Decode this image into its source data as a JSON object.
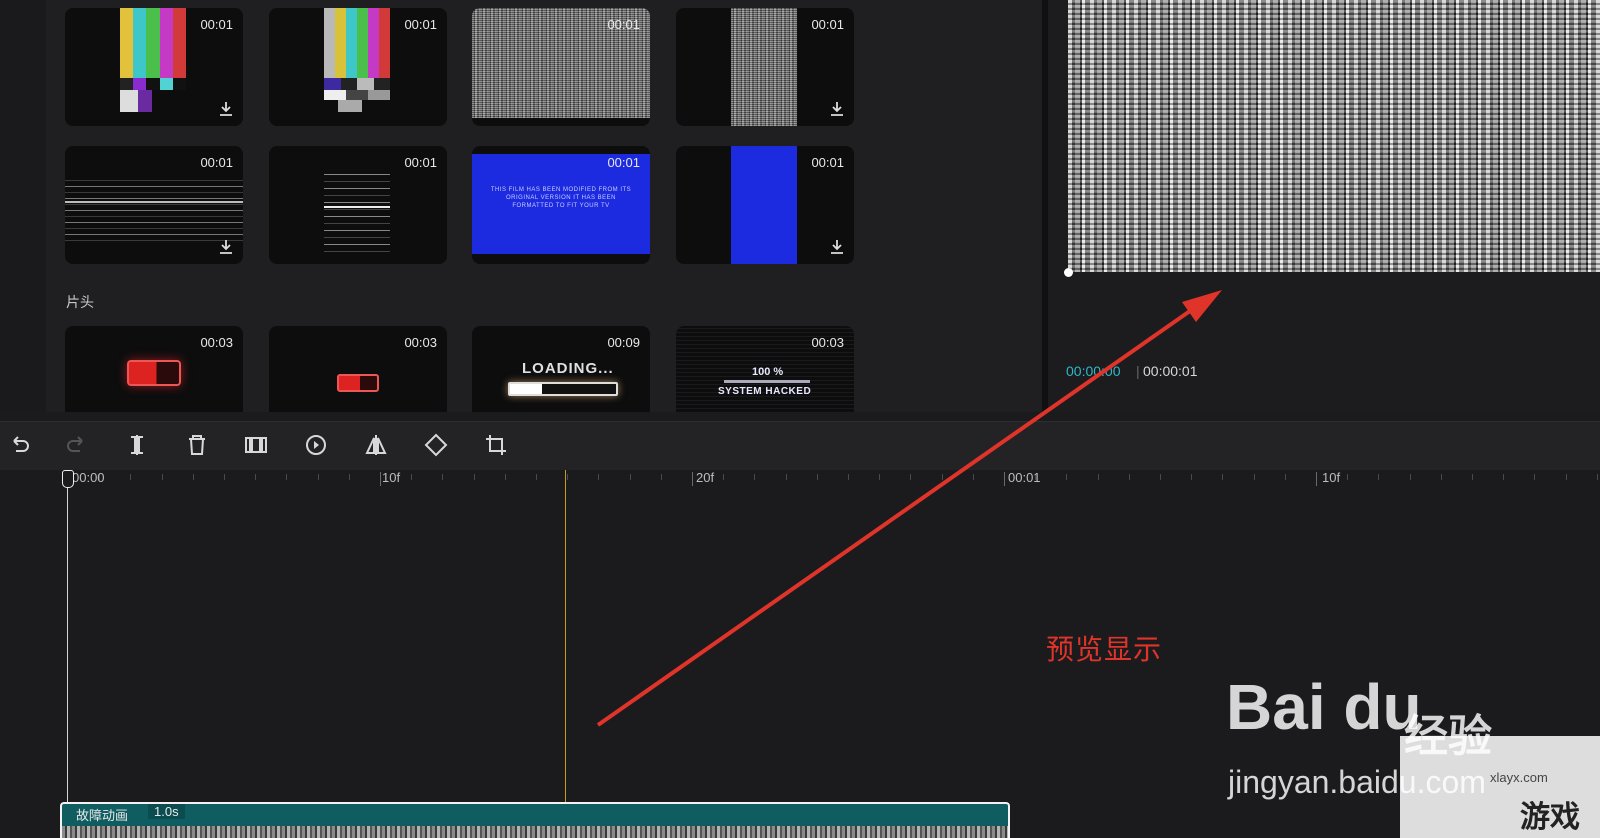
{
  "media": {
    "cards": [
      {
        "duration": "00:01",
        "style": "bars"
      },
      {
        "duration": "00:01",
        "style": "bars-narrow"
      },
      {
        "duration": "00:01",
        "style": "noise"
      },
      {
        "duration": "00:01",
        "style": "noise-narrow"
      },
      {
        "duration": "00:01",
        "style": "lines"
      },
      {
        "duration": "00:01",
        "style": "lines-narrow"
      },
      {
        "duration": "00:01",
        "style": "blue",
        "text": "THIS FILM HAS BEEN MODIFIED FROM ITS ORIGINAL VERSION IT HAS BEEN FORMATTED TO FIT YOUR TV"
      },
      {
        "duration": "00:01",
        "style": "blue-narrow"
      }
    ],
    "section_label": "片头",
    "intro_cards": [
      {
        "duration": "00:03",
        "style": "battery"
      },
      {
        "duration": "00:03",
        "style": "battery-small"
      },
      {
        "duration": "00:09",
        "style": "loading",
        "text": "LOADING..."
      },
      {
        "duration": "00:03",
        "style": "hacked",
        "text_top": "100 %",
        "text_bottom": "SYSTEM HACKED"
      }
    ]
  },
  "preview": {
    "time_current": "00:00:00",
    "time_separator": "|",
    "time_total": "00:00:01"
  },
  "toolbar": {
    "icons": [
      "undo-icon",
      "redo-icon",
      "split-icon",
      "delete-icon",
      "freeze-icon",
      "play-speed-icon",
      "mirror-icon",
      "rotate-icon",
      "crop-icon"
    ]
  },
  "ruler": {
    "labels": [
      "00:00",
      "10f",
      "20f",
      "00:01",
      "10f"
    ]
  },
  "clip": {
    "name": "故障动画",
    "duration": "1.0s"
  },
  "annotation": {
    "text": "预览显示",
    "color": "#e0342a"
  },
  "watermark": {
    "brand": "Bai du",
    "brand_cn": "经验",
    "url": "jingyan.baidu.com",
    "site_url": "xlayx.com",
    "site_cn": "游戏"
  },
  "colors": {
    "accent": "#2fb7c9",
    "clip": "#0f5d61",
    "marker": "#c79a1e"
  }
}
